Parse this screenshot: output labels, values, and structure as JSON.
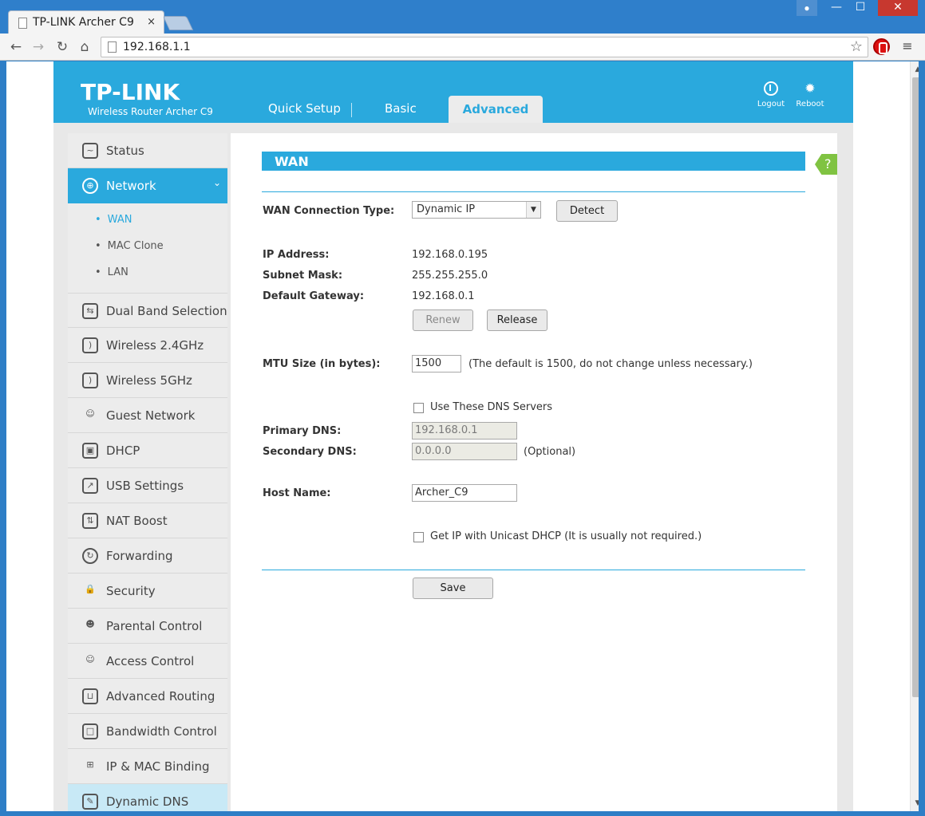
{
  "browser": {
    "tab_title": "TP-LINK Archer C9",
    "tab_close": "×",
    "url": "192.168.1.1",
    "win_min": "—",
    "win_max": "☐",
    "win_close": "✕",
    "back": "←",
    "forward": "→",
    "reload": "↻",
    "home": "⌂",
    "star": "☆",
    "menu": "≡"
  },
  "header": {
    "logo": "TP-LINK",
    "model": "Wireless Router Archer C9",
    "nav": [
      "Quick Setup",
      "Basic",
      "Advanced"
    ],
    "logout": "Logout",
    "reboot": "Reboot"
  },
  "sidebar": {
    "items": [
      {
        "label": "Status",
        "icon": "status-icon"
      },
      {
        "label": "Network",
        "icon": "globe-icon"
      },
      {
        "label": "Dual Band Selection",
        "icon": "dual-band-icon"
      },
      {
        "label": "Wireless 2.4GHz",
        "icon": "wireless-icon"
      },
      {
        "label": "Wireless 5GHz",
        "icon": "wireless-icon"
      },
      {
        "label": "Guest Network",
        "icon": "guests-icon"
      },
      {
        "label": "DHCP",
        "icon": "dhcp-icon"
      },
      {
        "label": "USB Settings",
        "icon": "usb-icon"
      },
      {
        "label": "NAT Boost",
        "icon": "nat-icon"
      },
      {
        "label": "Forwarding",
        "icon": "forwarding-icon"
      },
      {
        "label": "Security",
        "icon": "lock-icon"
      },
      {
        "label": "Parental Control",
        "icon": "parental-icon"
      },
      {
        "label": "Access Control",
        "icon": "access-icon"
      },
      {
        "label": "Advanced Routing",
        "icon": "routing-icon"
      },
      {
        "label": "Bandwidth Control",
        "icon": "bandwidth-icon"
      },
      {
        "label": "IP & MAC Binding",
        "icon": "binding-icon"
      },
      {
        "label": "Dynamic DNS",
        "icon": "ddns-icon"
      }
    ],
    "sub": [
      "WAN",
      "MAC Clone",
      "LAN"
    ]
  },
  "wan": {
    "title": "WAN",
    "help": "?",
    "conn_type_label": "WAN Connection Type:",
    "conn_type_value": "Dynamic IP",
    "detect": "Detect",
    "ip_label": "IP Address:",
    "ip_value": "192.168.0.195",
    "mask_label": "Subnet Mask:",
    "mask_value": "255.255.255.0",
    "gw_label": "Default Gateway:",
    "gw_value": "192.168.0.1",
    "renew": "Renew",
    "release": "Release",
    "mtu_label": "MTU Size (in bytes):",
    "mtu_value": "1500",
    "mtu_hint": "(The default is 1500, do not change unless necessary.)",
    "use_dns": "Use These DNS Servers",
    "pdns_label": "Primary DNS:",
    "pdns_value": "192.168.0.1",
    "sdns_label": "Secondary DNS:",
    "sdns_value": "0.0.0.0",
    "optional": "(Optional)",
    "host_label": "Host Name:",
    "host_value": "Archer_C9",
    "unicast": "Get IP with Unicast DHCP (It is usually not required.)",
    "save": "Save"
  }
}
